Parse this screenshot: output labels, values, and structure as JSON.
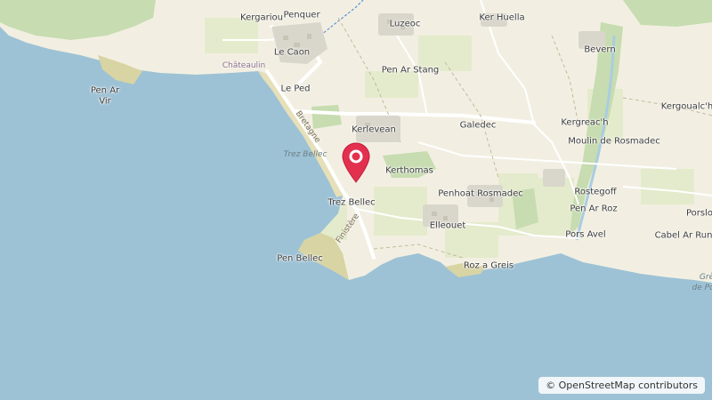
{
  "map": {
    "colors": {
      "sea": "#9dc2d5",
      "land": "#f2efe2",
      "beach": "#e6dfb8",
      "field": "#e4ebcc",
      "wood": "#c7dcb0",
      "marker": "#e3304f"
    },
    "places": [
      {
        "name": "Kergariou"
      },
      {
        "name": "Penquer"
      },
      {
        "name": "Luzeoc"
      },
      {
        "name": "Ker Huella"
      },
      {
        "name": "Le Caon"
      },
      {
        "name": "Bevern"
      },
      {
        "name": "Pen Ar Stang"
      },
      {
        "name": "Pen Ar"
      },
      {
        "name": "Vir"
      },
      {
        "name": "Le Ped"
      },
      {
        "name": "Kergoualc'h"
      },
      {
        "name": "Kergreac'h"
      },
      {
        "name": "Galedec"
      },
      {
        "name": "Kerlevean"
      },
      {
        "name": "Moulin de Rosmadec"
      },
      {
        "name": "Kerthomas"
      },
      {
        "name": "Rostegoff"
      },
      {
        "name": "Penhoat Rosmadec"
      },
      {
        "name": "Trez Bellec"
      },
      {
        "name": "Pen Ar Roz"
      },
      {
        "name": "Porslo"
      },
      {
        "name": "Elleouet"
      },
      {
        "name": "Pors Avel"
      },
      {
        "name": "Cabel Ar Run"
      },
      {
        "name": "Pen Bellec"
      },
      {
        "name": "Roz a Greis"
      }
    ],
    "water_labels": {
      "beach": "Trez Bellec",
      "bay_line1": "Grè",
      "bay_line2": "de Po"
    },
    "road_labels": {
      "bretagne": "Bretagne",
      "finistere": "Finistère"
    },
    "admin_label": "Châteaulin"
  },
  "marker": {
    "icon": "map-pin-icon",
    "location": "Trez Bellec"
  },
  "attribution": "© OpenStreetMap contributors"
}
